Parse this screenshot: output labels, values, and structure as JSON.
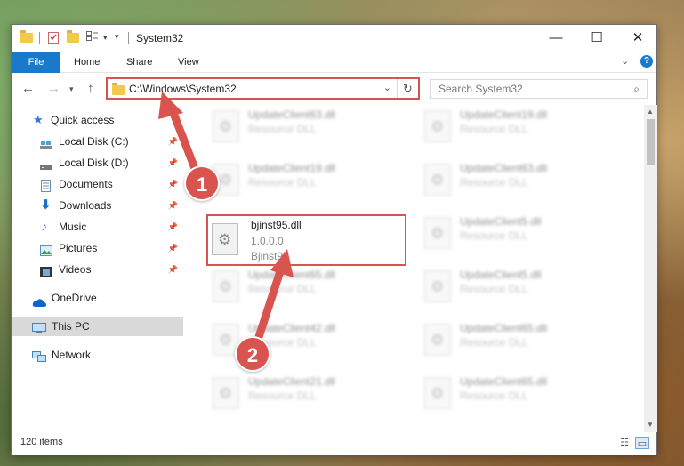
{
  "window": {
    "title": "System32",
    "minimize": "—",
    "maximize": "☐",
    "close": "✕"
  },
  "ribbon": {
    "tabs": [
      "File",
      "Home",
      "Share",
      "View"
    ],
    "expand": "⌄",
    "help": "?"
  },
  "address": {
    "path": "C:\\Windows\\System32",
    "search_placeholder": "Search System32"
  },
  "sidebar": {
    "quick_access": "Quick access",
    "items": [
      {
        "label": "Local Disk (C:)",
        "icon": "disk-icon"
      },
      {
        "label": "Local Disk (D:)",
        "icon": "disk-icon"
      },
      {
        "label": "Documents",
        "icon": "documents-icon"
      },
      {
        "label": "Downloads",
        "icon": "download-icon"
      },
      {
        "label": "Music",
        "icon": "music-icon"
      },
      {
        "label": "Pictures",
        "icon": "pictures-icon"
      },
      {
        "label": "Videos",
        "icon": "videos-icon"
      }
    ],
    "onedrive": "OneDrive",
    "this_pc": "This PC",
    "network": "Network"
  },
  "files": {
    "left": [
      {
        "name": "UpdateClient63.dll",
        "type": "Resource DLL"
      },
      {
        "name": "UpdateClient19.dll",
        "type": "Resource DLL"
      },
      {
        "name": "bjinst95.dll",
        "version": "1.0.0.0",
        "desc": "Bjinst95"
      },
      {
        "name": "UpdateClient65.dll",
        "type": "Resource DLL"
      },
      {
        "name": "UpdateClient42.dll",
        "type": "Resource DLL"
      },
      {
        "name": "UpdateClient21.dll",
        "type": "Resource DLL"
      }
    ],
    "right": [
      {
        "name": "UpdateClient19.dll",
        "type": "Resource DLL"
      },
      {
        "name": "UpdateClient63.dll",
        "type": "Resource DLL"
      },
      {
        "name": "UpdateClient5.dll",
        "type": "Resource DLL"
      },
      {
        "name": "UpdateClient5.dll",
        "type": "Resource DLL"
      },
      {
        "name": "UpdateClient65.dll",
        "type": "Resource DLL"
      },
      {
        "name": "UpdateClient65.dll",
        "type": "Resource DLL"
      }
    ]
  },
  "status": {
    "items": "120 items"
  },
  "annotations": {
    "step1": "1",
    "step2": "2",
    "color": "#d9534f"
  }
}
